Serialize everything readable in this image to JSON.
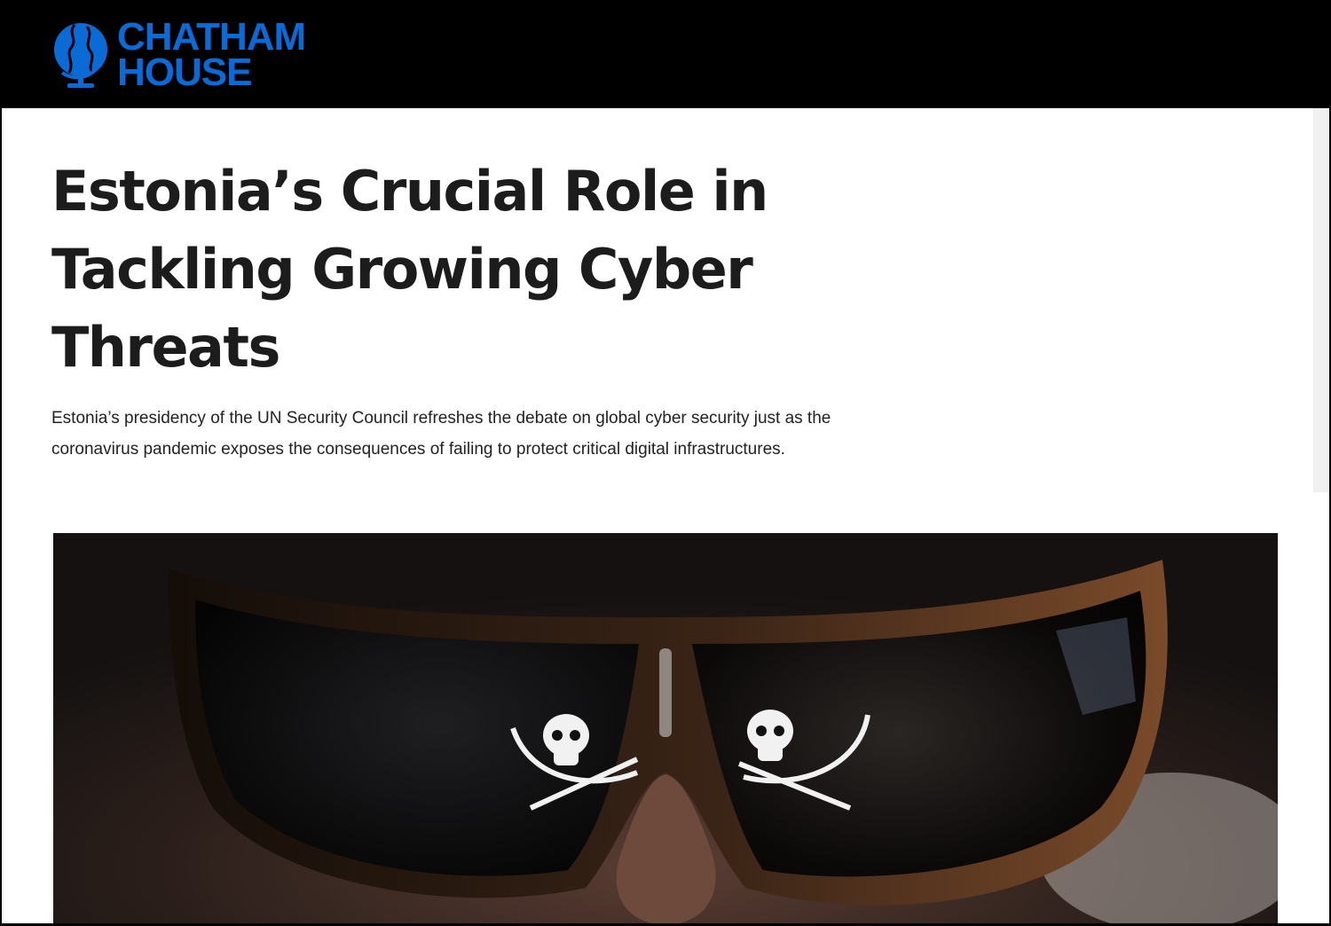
{
  "site": {
    "logo_line1": "CHATHAM",
    "logo_line2": "HOUSE",
    "brand_color": "#0a6bd6"
  },
  "article": {
    "title": "Estonia’s Crucial Role in Tackling Growing Cyber Threats",
    "summary": "Estonia’s presidency of the UN Security Council refreshes the debate on global cyber security just as the coronavirus pandemic exposes the consequences of failing to protect critical digital infrastructures."
  },
  "icons": [
    "globe-logo-icon",
    "skull-crossbones-icon"
  ]
}
